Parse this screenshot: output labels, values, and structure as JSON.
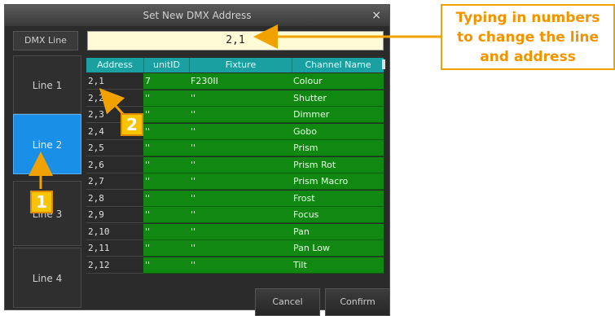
{
  "dialog": {
    "title": "Set New DMX Address",
    "close_glyph": "×",
    "dmx_line_label": "DMX Line",
    "dmx_line_value": "2,1",
    "lines": [
      {
        "label": "Line 1",
        "active": false
      },
      {
        "label": "Line 2",
        "active": true
      },
      {
        "label": "Line 3",
        "active": false
      },
      {
        "label": "Line 4",
        "active": false
      }
    ],
    "table": {
      "headers": [
        "Address",
        "unitID",
        "Fixture",
        "Channel Name"
      ],
      "rows": [
        {
          "address": "2,1",
          "unit": "7",
          "fixture": "F230II",
          "channel": "Colour"
        },
        {
          "address": "2,2",
          "unit": "''",
          "fixture": "''",
          "channel": "Shutter"
        },
        {
          "address": "2,3",
          "unit": "''",
          "fixture": "''",
          "channel": "Dimmer"
        },
        {
          "address": "2,4",
          "unit": "''",
          "fixture": "''",
          "channel": "Gobo"
        },
        {
          "address": "2,5",
          "unit": "''",
          "fixture": "''",
          "channel": "Prism"
        },
        {
          "address": "2,6",
          "unit": "''",
          "fixture": "''",
          "channel": "Prism  Rot"
        },
        {
          "address": "2,7",
          "unit": "''",
          "fixture": "''",
          "channel": "Prism  Macro"
        },
        {
          "address": "2,8",
          "unit": "''",
          "fixture": "''",
          "channel": "Frost"
        },
        {
          "address": "2,9",
          "unit": "''",
          "fixture": "''",
          "channel": "Focus"
        },
        {
          "address": "2,10",
          "unit": "''",
          "fixture": "''",
          "channel": "Pan"
        },
        {
          "address": "2,11",
          "unit": "''",
          "fixture": "''",
          "channel": "Pan  Low"
        },
        {
          "address": "2,12",
          "unit": "''",
          "fixture": "''",
          "channel": "Tilt"
        }
      ]
    },
    "cancel_label": "Cancel",
    "confirm_label": "Confirm"
  },
  "annotations": {
    "badge_1": "1",
    "badge_2": "2",
    "callout_text": "Typing in numbers\nto change the line\nand address",
    "accent_color": "#f2a200"
  }
}
